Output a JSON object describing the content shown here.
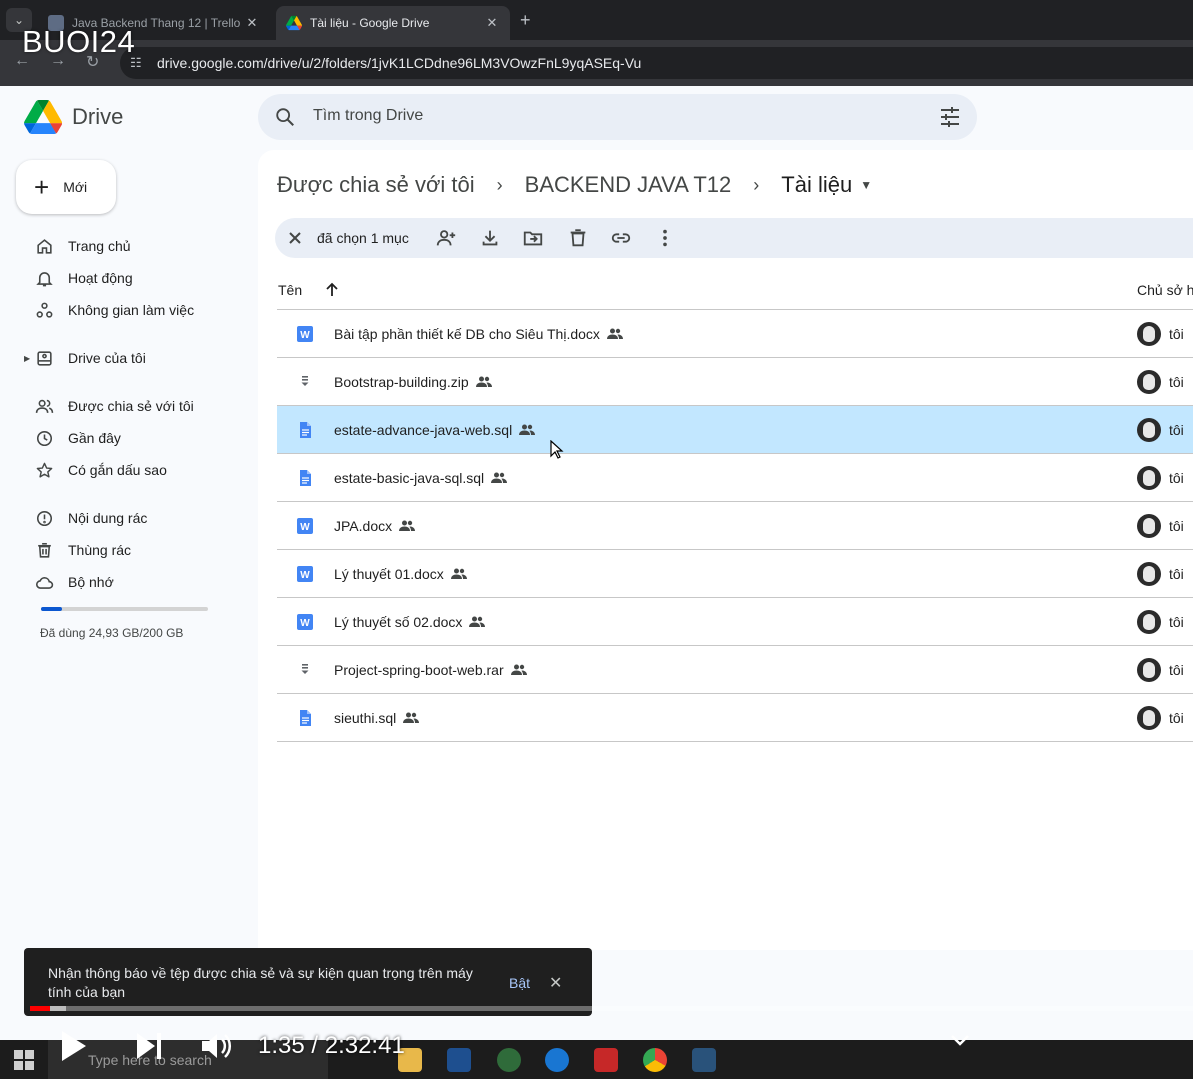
{
  "overlay": {
    "title": "BUOI24"
  },
  "browser": {
    "tabs": [
      {
        "label": "Java Backend Thang 12 | Trello",
        "close": "✕",
        "favicon_color": "#5e6c84"
      },
      {
        "label": "Tài liệu - Google Drive",
        "close": "✕",
        "favicon_color": "#34a853"
      }
    ],
    "new_tab": "+",
    "url": "drive.google.com/drive/u/2/folders/1jvK1LCDdne96LM3VOwzFnL9yqASEq-Vu"
  },
  "drive": {
    "app_name": "Drive",
    "search_placeholder": "Tìm trong Drive",
    "new_button": "Mới",
    "nav": [
      {
        "label": "Trang chủ",
        "icon": "home-icon"
      },
      {
        "label": "Hoạt động",
        "icon": "bell-icon"
      },
      {
        "label": "Không gian làm việc",
        "icon": "workspaces-icon"
      },
      {
        "label": "Drive của tôi",
        "icon": "my-drive-icon"
      },
      {
        "label": "Được chia sẻ với tôi",
        "icon": "shared-people-icon"
      },
      {
        "label": "Gần đây",
        "icon": "clock-icon"
      },
      {
        "label": "Có gắn dấu sao",
        "icon": "star-icon"
      },
      {
        "label": "Nội dung rác",
        "icon": "spam-icon"
      },
      {
        "label": "Thùng rác",
        "icon": "trash-icon"
      },
      {
        "label": "Bộ nhớ",
        "icon": "cloud-icon"
      }
    ],
    "storage": {
      "text": "Đã dùng 24,93 GB/200 GB",
      "used_fraction": 0.125
    },
    "breadcrumb": [
      "Được chia sẻ với tôi",
      "BACKEND JAVA T12",
      "Tài liệu"
    ],
    "selection": {
      "count_label": "đã chọn 1 mục"
    },
    "columns": {
      "name": "Tên",
      "owner": "Chủ sở h"
    },
    "files": [
      {
        "name": "Bài tập phần thiết kế DB cho Siêu Thị.docx",
        "type": "word",
        "owner": "tôi",
        "selected": false
      },
      {
        "name": "Bootstrap-building.zip",
        "type": "archive",
        "owner": "tôi",
        "selected": false
      },
      {
        "name": "estate-advance-java-web.sql",
        "type": "doc",
        "owner": "tôi",
        "selected": true
      },
      {
        "name": "estate-basic-java-sql.sql",
        "type": "doc",
        "owner": "tôi",
        "selected": false
      },
      {
        "name": "JPA.docx",
        "type": "word",
        "owner": "tôi",
        "selected": false
      },
      {
        "name": "Lý thuyết 01.docx",
        "type": "word",
        "owner": "tôi",
        "selected": false
      },
      {
        "name": "Lý thuyết số 02.docx",
        "type": "word",
        "owner": "tôi",
        "selected": false
      },
      {
        "name": "Project-spring-boot-web.rar",
        "type": "archive",
        "owner": "tôi",
        "selected": false
      },
      {
        "name": "sieuthi.sql",
        "type": "doc",
        "owner": "tôi",
        "selected": false
      }
    ],
    "toast": {
      "message": "Nhận thông báo về tệp được chia sẻ và sự kiện quan trọng trên máy tính của bạn",
      "action": "Bật",
      "close": "✕"
    }
  },
  "player": {
    "time": "1:35 / 2:32:41",
    "played_fraction": 0.017,
    "loaded_fraction": 0.031
  },
  "taskbar": {
    "search_placeholder": "Type here to search"
  },
  "colors": {
    "selected_row": "#c2e7ff",
    "word_blue": "#4285f4",
    "accent": "#0b57d0"
  }
}
